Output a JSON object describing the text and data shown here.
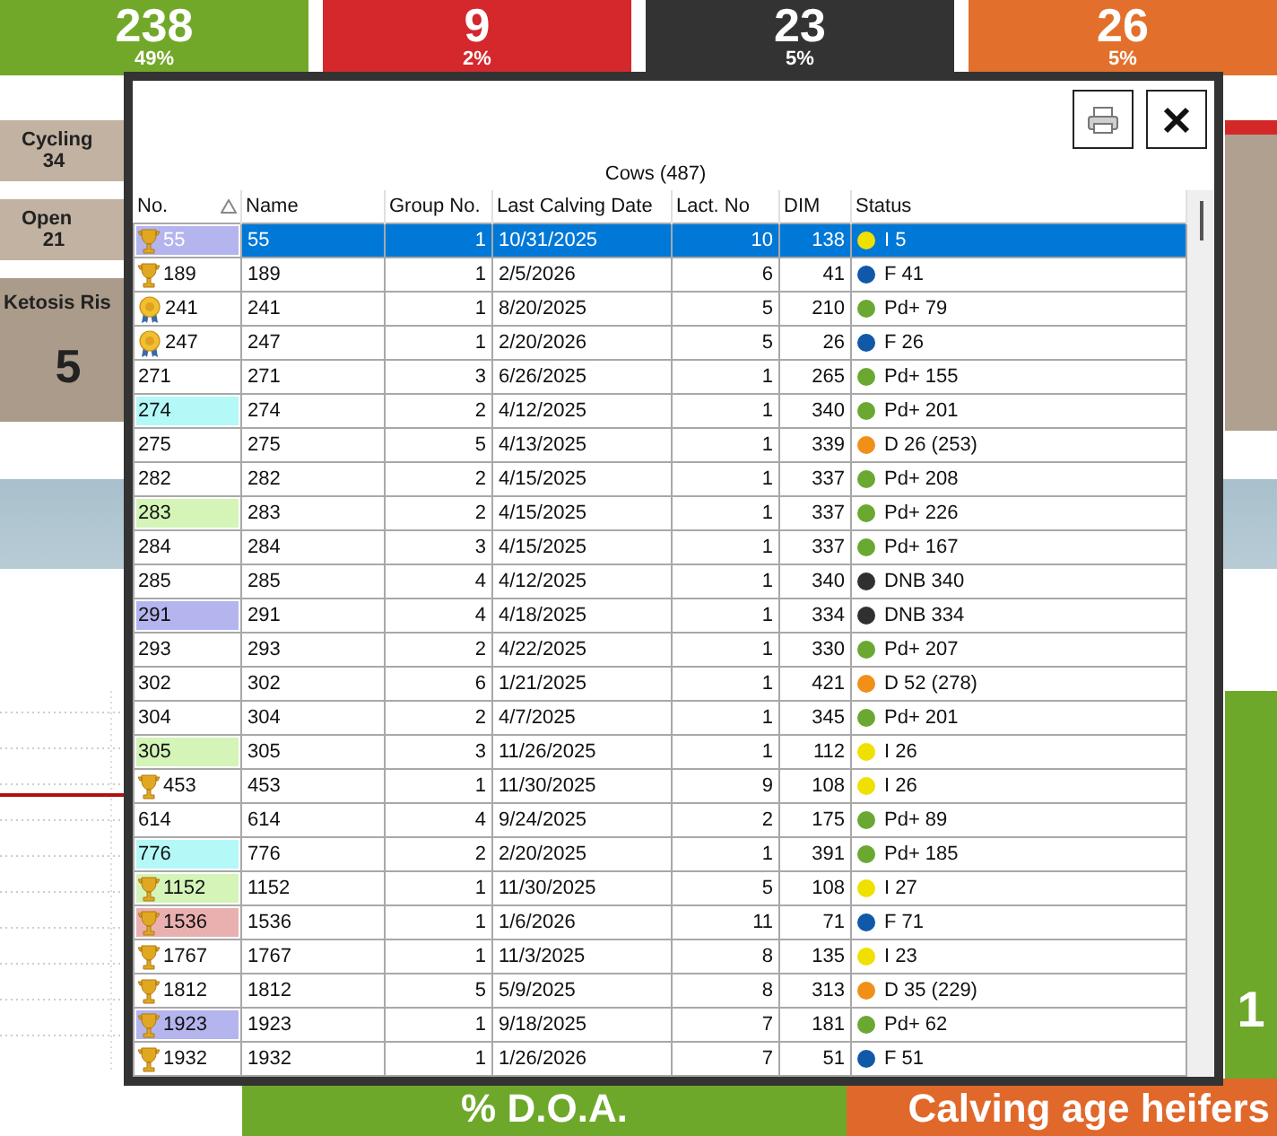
{
  "summary_tiles": [
    {
      "value": "238",
      "percent": "49%",
      "color": "#72a82a"
    },
    {
      "value": "9",
      "percent": "2%",
      "color": "#d4282c"
    },
    {
      "value": "23",
      "percent": "5%",
      "color": "#333333"
    },
    {
      "value": "26",
      "percent": "5%",
      "color": "#e2702c"
    }
  ],
  "side_tiles": [
    {
      "label": "Cycling",
      "value": "34",
      "kind": "small"
    },
    {
      "label": "Open",
      "value": "21",
      "kind": "small"
    },
    {
      "label": "Ketosis Ris",
      "value": "5",
      "kind": "large"
    }
  ],
  "right_tile": {
    "value": "1"
  },
  "bottom_tiles": [
    {
      "label": "% D.O.A.",
      "color": "#6ea82a"
    },
    {
      "label": "Calving age heifers",
      "color": "#e0682a"
    }
  ],
  "dialog": {
    "title": "Cows (487)",
    "columns": [
      {
        "label": "No.",
        "sorted": true
      },
      {
        "label": "Name",
        "sorted": false
      },
      {
        "label": "Group No.",
        "sorted": false
      },
      {
        "label": "Last Calving Date",
        "sorted": false
      },
      {
        "label": "Lact. No",
        "sorted": false
      },
      {
        "label": "DIM",
        "sorted": false
      },
      {
        "label": "Status",
        "sorted": false
      }
    ],
    "rows": [
      {
        "no": "55",
        "kind": "trophy",
        "color": "#b4b4ee",
        "name": "55",
        "group": "1",
        "date": "10/31/2025",
        "lact": "10",
        "dim": "138",
        "status": {
          "text": "I 5",
          "color": "#f0e000"
        },
        "selected": true
      },
      {
        "no": "189",
        "kind": "trophy",
        "name": "189",
        "group": "1",
        "date": "2/5/2026",
        "lact": "6",
        "dim": "41",
        "status": {
          "text": "F 41",
          "color": "#1058a8"
        },
        "selected": false
      },
      {
        "no": "241",
        "kind": "medal",
        "name": "241",
        "group": "1",
        "date": "8/20/2025",
        "lact": "5",
        "dim": "210",
        "status": {
          "text": "Pd+ 79",
          "color": "#6aa832"
        },
        "selected": false
      },
      {
        "no": "247",
        "kind": "medal",
        "name": "247",
        "group": "1",
        "date": "2/20/2026",
        "lact": "5",
        "dim": "26",
        "status": {
          "text": "F 26",
          "color": "#1058a8"
        },
        "selected": false
      },
      {
        "no": "271",
        "kind": "plain",
        "name": "271",
        "group": "3",
        "date": "6/26/2025",
        "lact": "1",
        "dim": "265",
        "status": {
          "text": "Pd+ 155",
          "color": "#6aa832"
        },
        "selected": false
      },
      {
        "no": "274",
        "kind": "plain",
        "color": "#b4f8f8",
        "name": "274",
        "group": "2",
        "date": "4/12/2025",
        "lact": "1",
        "dim": "340",
        "status": {
          "text": "Pd+ 201",
          "color": "#6aa832"
        },
        "selected": false
      },
      {
        "no": "275",
        "kind": "plain",
        "name": "275",
        "group": "5",
        "date": "4/13/2025",
        "lact": "1",
        "dim": "339",
        "status": {
          "text": "D 26 (253)",
          "color": "#f09018"
        },
        "selected": false
      },
      {
        "no": "282",
        "kind": "plain",
        "name": "282",
        "group": "2",
        "date": "4/15/2025",
        "lact": "1",
        "dim": "337",
        "status": {
          "text": "Pd+ 208",
          "color": "#6aa832"
        },
        "selected": false
      },
      {
        "no": "283",
        "kind": "plain",
        "color": "#d4f4b8",
        "name": "283",
        "group": "2",
        "date": "4/15/2025",
        "lact": "1",
        "dim": "337",
        "status": {
          "text": "Pd+ 226",
          "color": "#6aa832"
        },
        "selected": false
      },
      {
        "no": "284",
        "kind": "plain",
        "name": "284",
        "group": "3",
        "date": "4/15/2025",
        "lact": "1",
        "dim": "337",
        "status": {
          "text": "Pd+ 167",
          "color": "#6aa832"
        },
        "selected": false
      },
      {
        "no": "285",
        "kind": "plain",
        "name": "285",
        "group": "4",
        "date": "4/12/2025",
        "lact": "1",
        "dim": "340",
        "status": {
          "text": "DNB 340",
          "color": "#303030"
        },
        "selected": false
      },
      {
        "no": "291",
        "kind": "plain",
        "color": "#b4b4ee",
        "name": "291",
        "group": "4",
        "date": "4/18/2025",
        "lact": "1",
        "dim": "334",
        "status": {
          "text": "DNB 334",
          "color": "#303030"
        },
        "selected": false
      },
      {
        "no": "293",
        "kind": "plain",
        "name": "293",
        "group": "2",
        "date": "4/22/2025",
        "lact": "1",
        "dim": "330",
        "status": {
          "text": "Pd+ 207",
          "color": "#6aa832"
        },
        "selected": false
      },
      {
        "no": "302",
        "kind": "plain",
        "name": "302",
        "group": "6",
        "date": "1/21/2025",
        "lact": "1",
        "dim": "421",
        "status": {
          "text": "D 52 (278)",
          "color": "#f09018"
        },
        "selected": false
      },
      {
        "no": "304",
        "kind": "plain",
        "name": "304",
        "group": "2",
        "date": "4/7/2025",
        "lact": "1",
        "dim": "345",
        "status": {
          "text": "Pd+ 201",
          "color": "#6aa832"
        },
        "selected": false
      },
      {
        "no": "305",
        "kind": "plain",
        "color": "#d4f4b8",
        "name": "305",
        "group": "3",
        "date": "11/26/2025",
        "lact": "1",
        "dim": "112",
        "status": {
          "text": "I 26",
          "color": "#f0e000"
        },
        "selected": false
      },
      {
        "no": "453",
        "kind": "trophy",
        "name": "453",
        "group": "1",
        "date": "11/30/2025",
        "lact": "9",
        "dim": "108",
        "status": {
          "text": "I 26",
          "color": "#f0e000"
        },
        "selected": false
      },
      {
        "no": "614",
        "kind": "plain",
        "name": "614",
        "group": "4",
        "date": "9/24/2025",
        "lact": "2",
        "dim": "175",
        "status": {
          "text": "Pd+ 89",
          "color": "#6aa832"
        },
        "selected": false
      },
      {
        "no": "776",
        "kind": "plain",
        "color": "#b4f8f8",
        "name": "776",
        "group": "2",
        "date": "2/20/2025",
        "lact": "1",
        "dim": "391",
        "status": {
          "text": "Pd+ 185",
          "color": "#6aa832"
        },
        "selected": false
      },
      {
        "no": "1152",
        "kind": "trophy",
        "color": "#d4f4b8",
        "name": "1152",
        "group": "1",
        "date": "11/30/2025",
        "lact": "5",
        "dim": "108",
        "status": {
          "text": "I 27",
          "color": "#f0e000"
        },
        "selected": false
      },
      {
        "no": "1536",
        "kind": "trophy",
        "color": "#eab0b0",
        "name": "1536",
        "group": "1",
        "date": "1/6/2026",
        "lact": "11",
        "dim": "71",
        "status": {
          "text": "F 71",
          "color": "#1058a8"
        },
        "selected": false
      },
      {
        "no": "1767",
        "kind": "trophy",
        "name": "1767",
        "group": "1",
        "date": "11/3/2025",
        "lact": "8",
        "dim": "135",
        "status": {
          "text": "I 23",
          "color": "#f0e000"
        },
        "selected": false
      },
      {
        "no": "1812",
        "kind": "trophy",
        "name": "1812",
        "group": "5",
        "date": "5/9/2025",
        "lact": "8",
        "dim": "313",
        "status": {
          "text": "D 35 (229)",
          "color": "#f09018"
        },
        "selected": false
      },
      {
        "no": "1923",
        "kind": "trophy",
        "color": "#b4b4ee",
        "name": "1923",
        "group": "1",
        "date": "9/18/2025",
        "lact": "7",
        "dim": "181",
        "status": {
          "text": "Pd+ 62",
          "color": "#6aa832"
        },
        "selected": false
      },
      {
        "no": "1932",
        "kind": "trophy",
        "name": "1932",
        "group": "1",
        "date": "1/26/2026",
        "lact": "7",
        "dim": "51",
        "status": {
          "text": "F 51",
          "color": "#1058a8"
        },
        "selected": false
      }
    ]
  }
}
